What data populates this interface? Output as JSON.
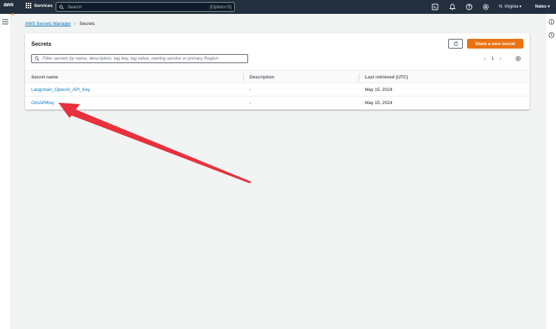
{
  "topnav": {
    "logo_text": "aws",
    "services_label": "Services",
    "search_placeholder": "Search",
    "search_shortcut": "[Option+S]",
    "region_label": "N. Virginia ▾",
    "user_label": "Nates ▾"
  },
  "breadcrumb": {
    "parent": "AWS Secrets Manager",
    "separator": "›",
    "current": "Secrets"
  },
  "panel": {
    "title": "Secrets",
    "store_button": "Store a new secret",
    "filter_placeholder": "Filter secrets by name, description, tag key, tag value, owning service or primary Region",
    "pager": {
      "prev": "‹",
      "page": "1",
      "next": "›"
    },
    "columns": [
      "Secret name",
      "Description",
      "Last retrieved (UTC)"
    ],
    "rows": [
      {
        "name": "Langchain_OpenAI_API_Key",
        "description": "-",
        "last_retrieved": "May 15, 2024"
      },
      {
        "name": "OAIAPIKey",
        "description": "-",
        "last_retrieved": "May 15, 2024"
      }
    ]
  },
  "colors": {
    "nav_bg": "#232f3e",
    "primary_button": "#ec7211",
    "link": "#0073bb",
    "annotation_arrow": "#e8313c"
  }
}
